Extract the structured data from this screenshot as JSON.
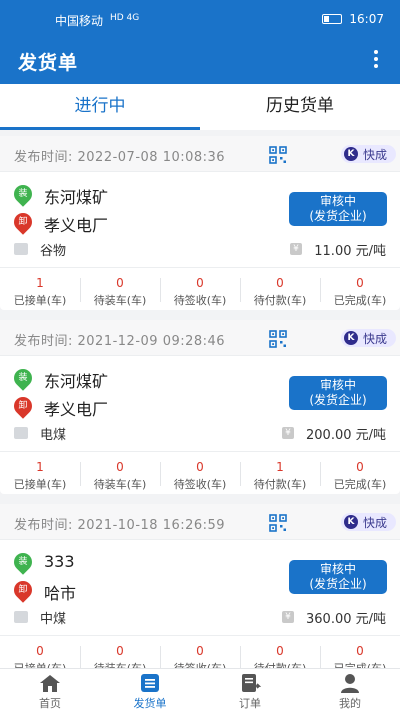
{
  "status_bar": {
    "carrier": "中国移动",
    "network": "HD 4G",
    "time": "16:07"
  },
  "app_bar": {
    "title": "发货单"
  },
  "tabs": [
    {
      "label": "进行中",
      "active": true
    },
    {
      "label": "历史货单",
      "active": false
    }
  ],
  "orders": [
    {
      "publish_time": "发布时间:  2022-07-08 10:08:36",
      "badge": "快成",
      "badge_k": "K",
      "load_tag": "装",
      "unload_tag": "卸",
      "load_place": "东河煤矿",
      "unload_place": "孝义电厂",
      "status_line1": "审核中",
      "status_line2": "(发货企业)",
      "goods": "谷物",
      "price_symbol": "¥",
      "price": "11.00 元/吨",
      "stats": [
        {
          "value": "1",
          "label": "已接单(车)"
        },
        {
          "value": "0",
          "label": "待装车(车)"
        },
        {
          "value": "0",
          "label": "待签收(车)"
        },
        {
          "value": "0",
          "label": "待付款(车)"
        },
        {
          "value": "0",
          "label": "已完成(车)"
        }
      ]
    },
    {
      "publish_time": "发布时间:  2021-12-09 09:28:46",
      "badge": "快成",
      "badge_k": "K",
      "load_tag": "装",
      "unload_tag": "卸",
      "load_place": "东河煤矿",
      "unload_place": "孝义电厂",
      "status_line1": "审核中",
      "status_line2": "(发货企业)",
      "goods": "电煤",
      "price_symbol": "¥",
      "price": "200.00 元/吨",
      "stats": [
        {
          "value": "1",
          "label": "已接单(车)"
        },
        {
          "value": "0",
          "label": "待装车(车)"
        },
        {
          "value": "0",
          "label": "待签收(车)"
        },
        {
          "value": "1",
          "label": "待付款(车)"
        },
        {
          "value": "0",
          "label": "已完成(车)"
        }
      ]
    },
    {
      "publish_time": "发布时间:  2021-10-18 16:26:59",
      "badge": "快成",
      "badge_k": "K",
      "load_tag": "装",
      "unload_tag": "卸",
      "load_place": "333",
      "unload_place": "哈市",
      "status_line1": "审核中",
      "status_line2": "(发货企业)",
      "goods": "中煤",
      "price_symbol": "¥",
      "price": "360.00 元/吨",
      "stats": [
        {
          "value": "0",
          "label": "已接单(车)"
        },
        {
          "value": "0",
          "label": "待装车(车)"
        },
        {
          "value": "0",
          "label": "待签收(车)"
        },
        {
          "value": "0",
          "label": "待付款(车)"
        },
        {
          "value": "0",
          "label": "已完成(车)"
        }
      ]
    }
  ],
  "bottom_nav": [
    {
      "label": "首页",
      "icon": "home-icon",
      "active": false
    },
    {
      "label": "发货单",
      "icon": "waybill-icon",
      "active": true
    },
    {
      "label": "订单",
      "icon": "order-icon",
      "active": false
    },
    {
      "label": "我的",
      "icon": "profile-icon",
      "active": false
    }
  ],
  "colors": {
    "primary": "#1a73c9",
    "accent_red": "#d9372a",
    "load_green": "#3fb34f",
    "background": "#f2f3f5"
  }
}
